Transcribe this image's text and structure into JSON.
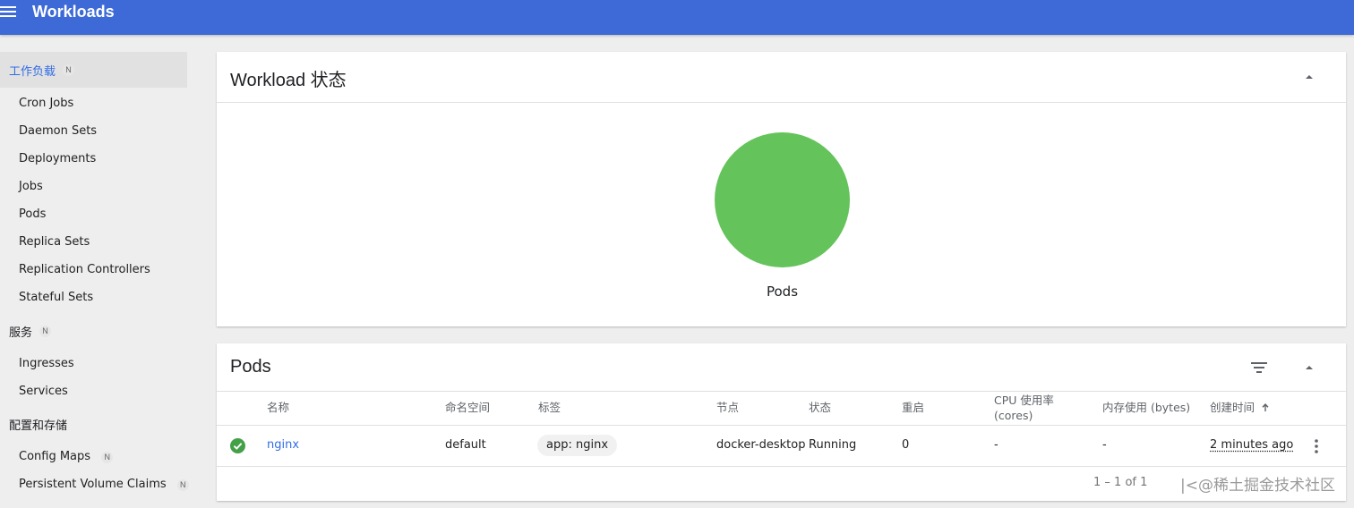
{
  "app": {
    "title": "Workloads"
  },
  "sidebar": {
    "workloads": {
      "label": "工作负载",
      "badge": "N",
      "items": [
        "Cron Jobs",
        "Daemon Sets",
        "Deployments",
        "Jobs",
        "Pods",
        "Replica Sets",
        "Replication Controllers",
        "Stateful Sets"
      ]
    },
    "services": {
      "label": "服务",
      "badge": "N",
      "items": [
        "Ingresses",
        "Services"
      ]
    },
    "config": {
      "label": "配置和存储",
      "items": [
        {
          "label": "Config Maps",
          "badge": "N"
        },
        {
          "label": "Persistent Volume Claims",
          "badge": "N"
        }
      ]
    }
  },
  "status_card": {
    "title": "Workload 状态",
    "chart_label": "Pods"
  },
  "chart_data": {
    "type": "pie",
    "labels": [
      "Running"
    ],
    "values": [
      1
    ],
    "colors": [
      "#65c35b"
    ]
  },
  "pods_card": {
    "title": "Pods",
    "columns": {
      "name": "名称",
      "namespace": "命名空间",
      "labels": "标签",
      "node": "节点",
      "status": "状态",
      "restarts": "重启",
      "cpu_line1": "CPU 使用率",
      "cpu_line2": "(cores)",
      "memory": "内存使用 (bytes)",
      "created": "创建时间"
    },
    "rows": [
      {
        "name": "nginx",
        "namespace": "default",
        "label": "app: nginx",
        "node": "docker-desktop",
        "status": "Running",
        "restarts": "0",
        "cpu": "-",
        "memory": "-",
        "created": "2 minutes ago"
      }
    ],
    "pagination": "1 – 1 of 1"
  },
  "watermark": "|<@稀土掘金技术社区",
  "colors": {
    "topbar": "#3d6ad6",
    "accent": "#326de6",
    "running": "#65c35b",
    "success": "#43a047"
  }
}
